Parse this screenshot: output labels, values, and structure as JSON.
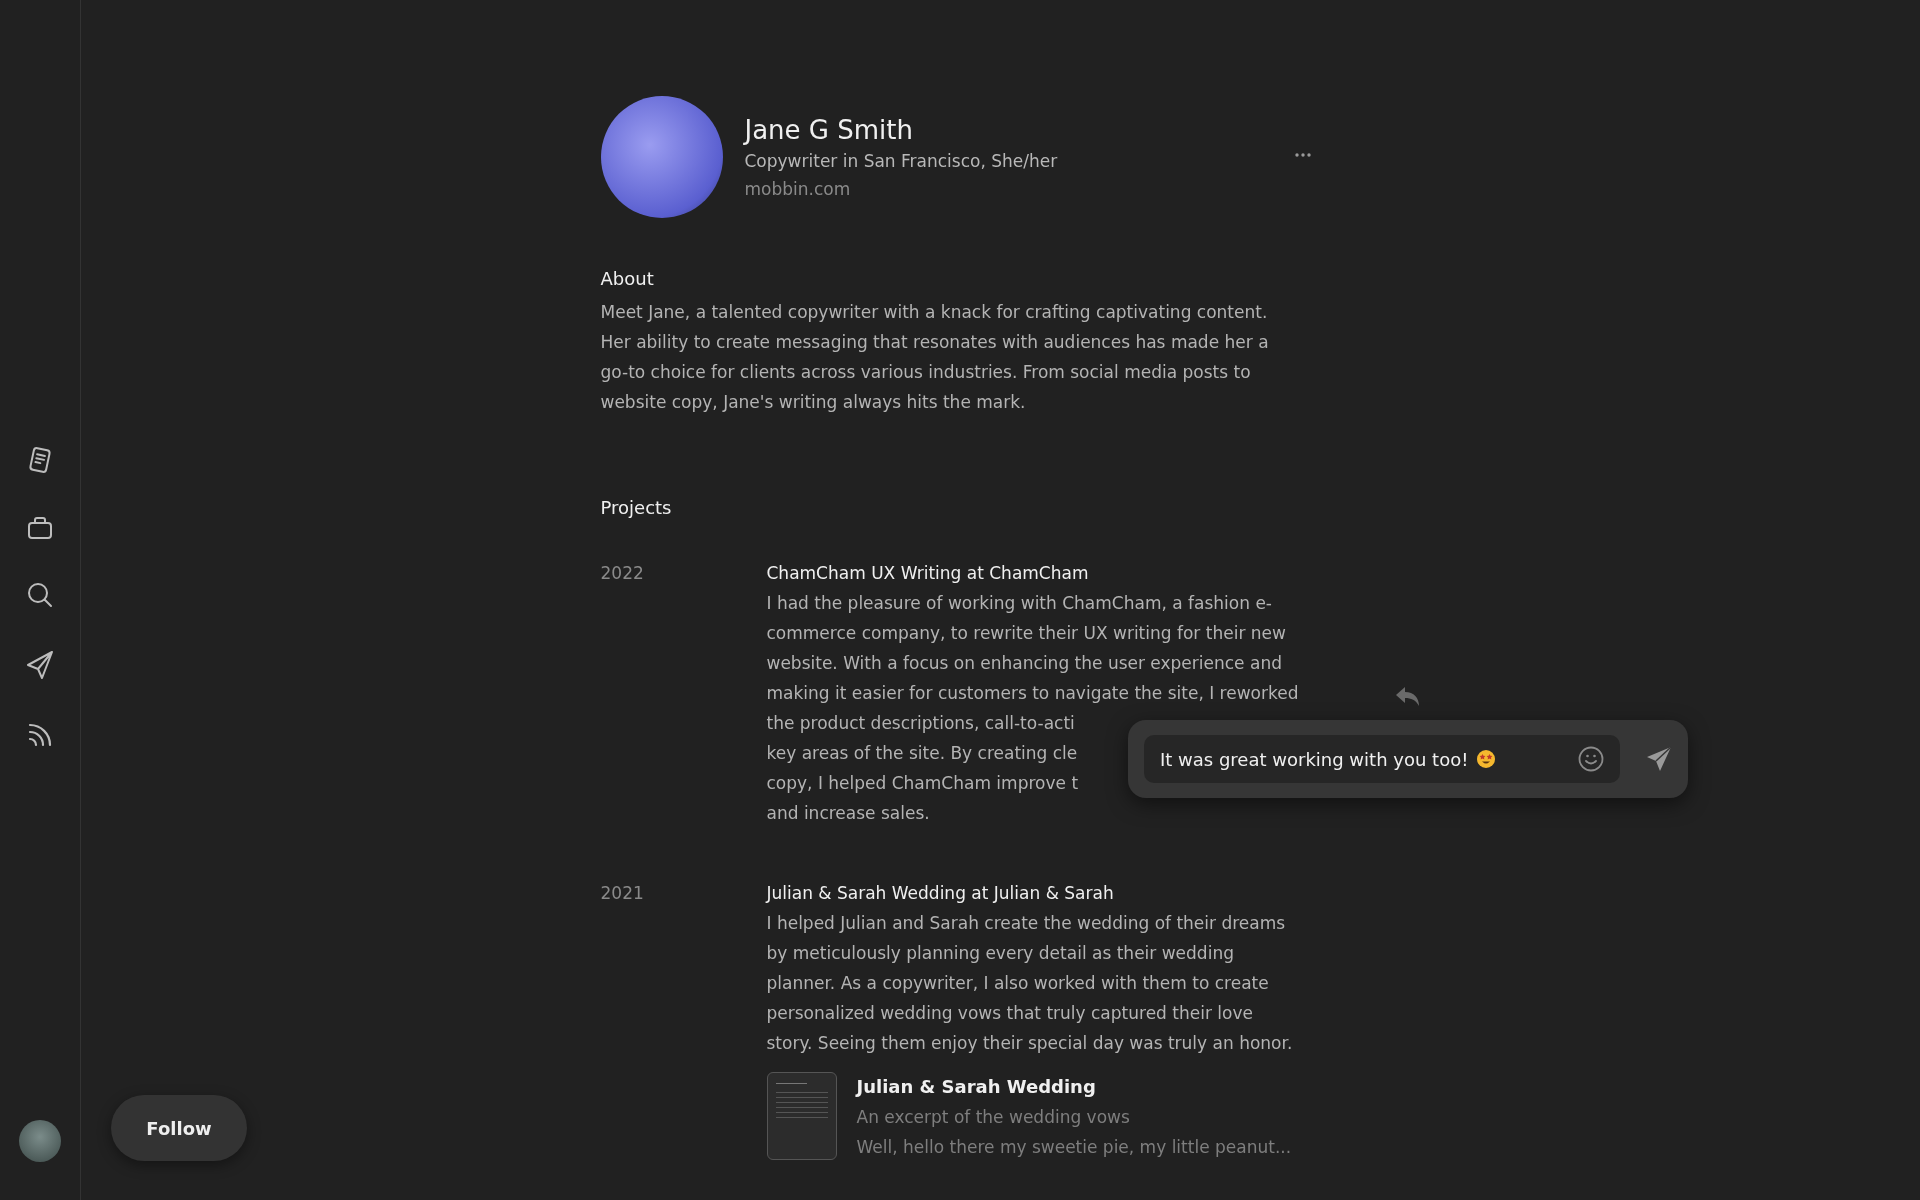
{
  "profile": {
    "name": "Jane G Smith",
    "headline": "Copywriter in San Francisco, She/her",
    "website": "mobbin.com"
  },
  "about": {
    "heading": "About",
    "lines": [
      "Meet Jane, a talented copywriter with a knack for crafting captivating content.",
      "Her ability to create messaging that resonates with audiences has made her a",
      "go-to choice for clients across various industries. From social media posts to",
      "website copy, Jane's writing always hits the mark."
    ]
  },
  "projects": {
    "heading": "Projects",
    "items": [
      {
        "year": "2022",
        "title": "ChamCham UX Writing at ChamCham",
        "lines": [
          "I had the pleasure of working with ChamCham, a fashion e-",
          "commerce company, to rewrite their UX writing for their new",
          "website. With a focus on enhancing the user experience and",
          "making it easier for customers to navigate the site, I reworked",
          "the product descriptions, call-to-acti",
          "key areas of the site. By creating cle",
          "copy, I helped ChamCham improve t",
          "and increase sales."
        ]
      },
      {
        "year": "2021",
        "title": "Julian & Sarah Wedding at Julian & Sarah",
        "lines": [
          "I helped Julian and Sarah create the wedding of their dreams",
          "by meticulously planning every detail as their wedding",
          "planner. As a copywriter, I also worked with them to create",
          "personalized wedding vows that truly captured their love",
          "story. Seeing them enjoy their special day was truly an honor."
        ],
        "attachment": {
          "title": "Julian & Sarah Wedding",
          "subtitle": "An excerpt of the wedding vows",
          "excerpt": "Well, hello there my sweetie pie, my little peanut..."
        }
      }
    ]
  },
  "reply_popup": {
    "message": "It was great working with you too!"
  },
  "follow_button": {
    "label": "Follow"
  }
}
